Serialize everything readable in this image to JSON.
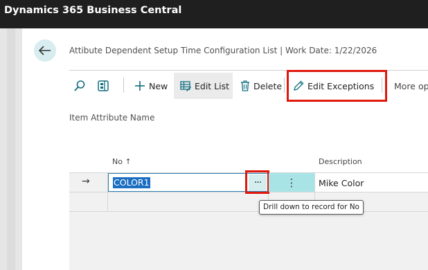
{
  "app": {
    "title": "Dynamics 365 Business Central"
  },
  "page": {
    "title": "Attibute Dependent Setup Time Configuration List | Work Date: 1/22/2026"
  },
  "toolbar": {
    "new_label": "New",
    "edit_list_label": "Edit List",
    "delete_label": "Delete",
    "edit_exceptions_label": "Edit Exceptions",
    "more_label": "More op"
  },
  "filter": {
    "label": "Item Attribute Name"
  },
  "grid": {
    "columns": {
      "no": "No",
      "no_sort": "↑",
      "description": "Description"
    },
    "rows": [
      {
        "no": "COLOR1",
        "description": "Mike Color",
        "current": true
      }
    ],
    "row_indicator": "→",
    "drilldown_label": "···",
    "kebab_label": "⋮"
  },
  "tooltip": {
    "text": "Drill down to record for No"
  },
  "colors": {
    "accent": "#0f6c7e",
    "highlight": "#e0180c",
    "selection": "#1b6ec2",
    "teal_cell": "#a8e4e6"
  }
}
